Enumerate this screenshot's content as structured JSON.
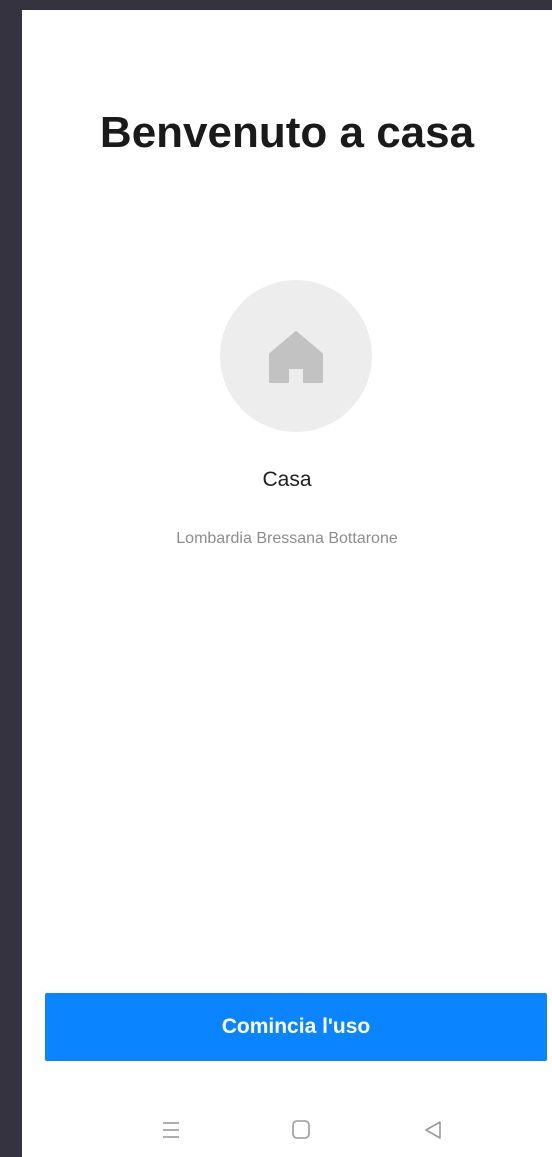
{
  "welcome": {
    "title": "Benvenuto a casa"
  },
  "home": {
    "icon": "house-icon",
    "name": "Casa",
    "location": "Lombardia Bressana Bottarone"
  },
  "actions": {
    "start_label": "Comincia l'uso"
  },
  "system_nav": {
    "menu_icon": "menu-lines-icon",
    "home_icon": "square-home-icon",
    "back_icon": "triangle-back-icon"
  },
  "colors": {
    "primary": "#0b84ff",
    "background": "#ffffff",
    "frame": "#34333f",
    "avatar_bg": "#ededed",
    "house_icon": "#c2c2c2"
  }
}
